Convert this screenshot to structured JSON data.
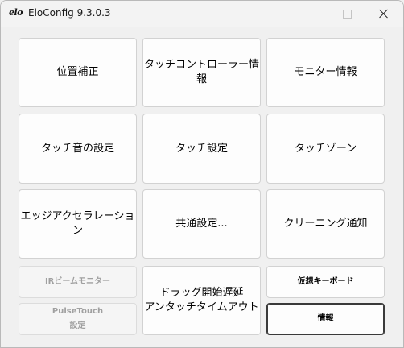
{
  "window": {
    "logo": "elo",
    "title": "EloConfig 9.3.0.3"
  },
  "buttons": {
    "calibration": "位置補正",
    "touch_controller_info": "タッチコントローラー情報",
    "monitor_info": "モニター情報",
    "touch_sound": "タッチ音の設定",
    "touch_settings": "タッチ設定",
    "touch_zone": "タッチゾーン",
    "edge_acceleration": "エッジアクセラレーション",
    "common_settings": "共通設定...",
    "cleaning_notice": "クリーニング通知",
    "ir_beam_monitor": "IRビームモニター",
    "pulsetouch_line1": "PulseTouch",
    "pulsetouch_line2": "設定",
    "drag_delay_line1": "ドラッグ開始遅延",
    "drag_delay_line2": "アンタッチタイムアウト",
    "virtual_keyboard": "仮想キーボード",
    "info": "情報"
  }
}
